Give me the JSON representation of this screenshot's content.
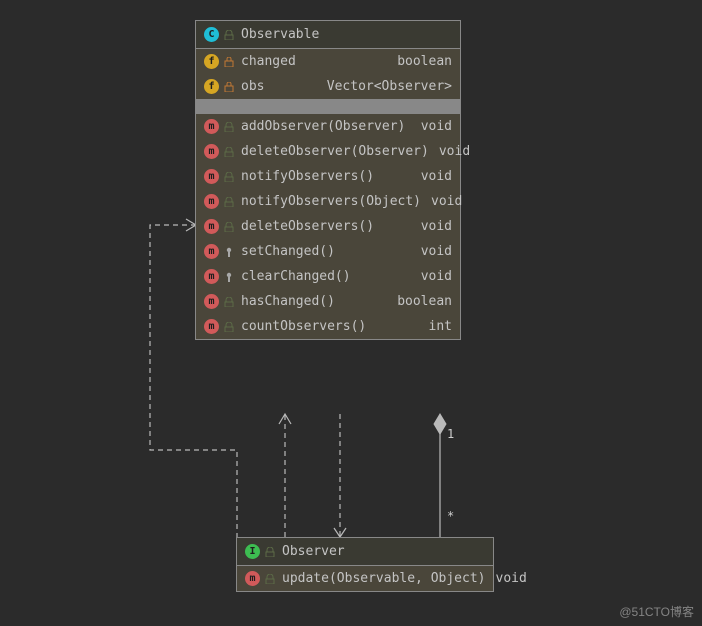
{
  "chart_data": {
    "type": "uml_class_diagram",
    "classes": [
      {
        "name": "Observable",
        "stereotype": "class",
        "fields": [
          {
            "name": "changed",
            "vis": "private",
            "type": "boolean"
          },
          {
            "name": "obs",
            "vis": "private",
            "type": "Vector<Observer>"
          }
        ],
        "methods": [
          {
            "sig": "addObserver(Observer)",
            "vis": "public",
            "ret": "void"
          },
          {
            "sig": "deleteObserver(Observer)",
            "vis": "public",
            "ret": "void"
          },
          {
            "sig": "notifyObservers()",
            "vis": "public",
            "ret": "void"
          },
          {
            "sig": "notifyObservers(Object)",
            "vis": "public",
            "ret": "void"
          },
          {
            "sig": "deleteObservers()",
            "vis": "public",
            "ret": "void"
          },
          {
            "sig": "setChanged()",
            "vis": "protected",
            "ret": "void"
          },
          {
            "sig": "clearChanged()",
            "vis": "protected",
            "ret": "void"
          },
          {
            "sig": "hasChanged()",
            "vis": "public",
            "ret": "boolean"
          },
          {
            "sig": "countObservers()",
            "vis": "public",
            "ret": "int"
          }
        ]
      },
      {
        "name": "Observer",
        "stereotype": "interface",
        "methods": [
          {
            "sig": "update(Observable, Object)",
            "vis": "public",
            "ret": "void"
          }
        ]
      }
    ],
    "relationships": [
      {
        "from": "Observable",
        "to": "Observer",
        "type": "composition",
        "mult_from": "1",
        "mult_to": "*"
      },
      {
        "from": "Observer",
        "to": "Observable",
        "type": "dependency"
      },
      {
        "from": "Observable",
        "to": "Observable",
        "type": "dependency_self"
      }
    ]
  },
  "observable": {
    "title": "Observable",
    "field_changed": "changed",
    "type_boolean": "boolean",
    "field_obs": "obs",
    "type_vector": "Vector<Observer>",
    "m_addObserver": "addObserver(Observer)",
    "m_deleteObserver": "deleteObserver(Observer)",
    "m_notifyObservers": "notifyObservers()",
    "m_notifyObserversObj": "notifyObservers(Object)",
    "m_deleteObservers": "deleteObservers()",
    "m_setChanged": "setChanged()",
    "m_clearChanged": "clearChanged()",
    "m_hasChanged": "hasChanged()",
    "m_countObservers": "countObservers()",
    "ret_void": "void",
    "ret_int": "int"
  },
  "observer": {
    "title": "Observer",
    "m_update": "update(Observable, Object)",
    "ret_void": "void"
  },
  "multiplicity": {
    "one": "1",
    "many": "*"
  },
  "watermark": "@51CTO博客"
}
